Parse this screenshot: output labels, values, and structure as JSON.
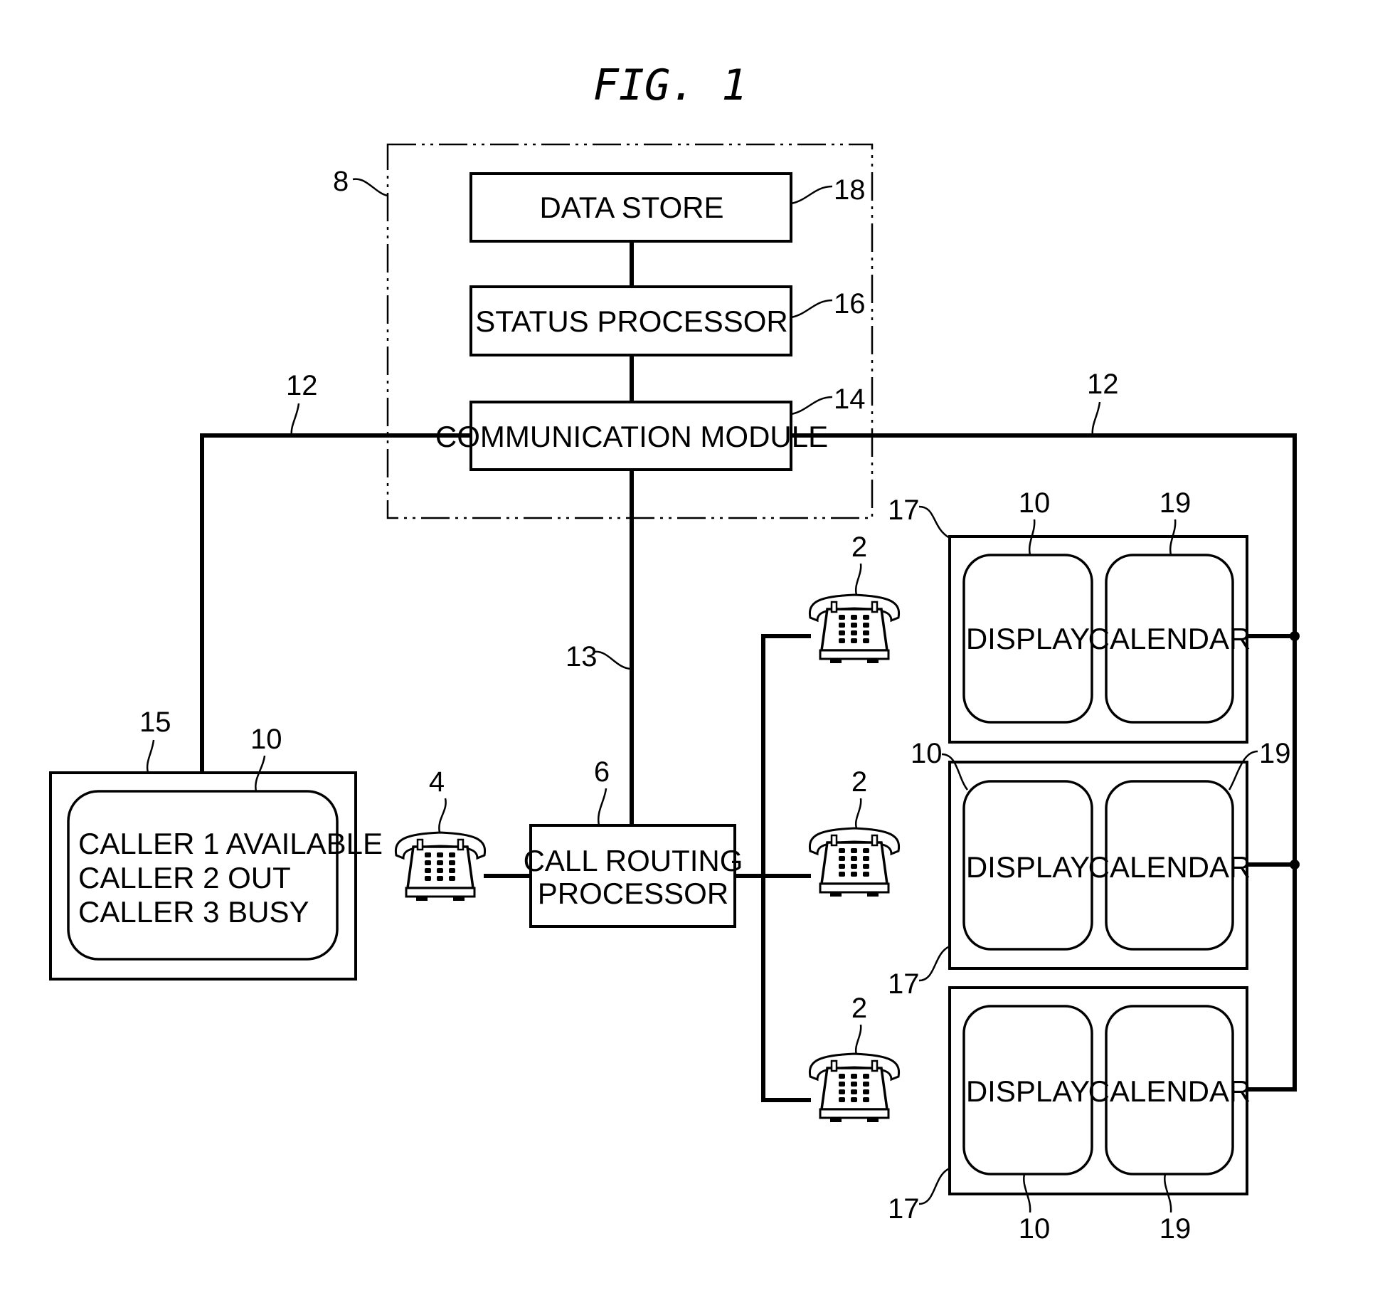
{
  "figure": {
    "title": "FIG. 1"
  },
  "system_boundary": {
    "ref": "8"
  },
  "blocks": {
    "data_store": {
      "label": "DATA STORE",
      "ref": "18"
    },
    "status_processor": {
      "label": "STATUS PROCESSOR",
      "ref": "16"
    },
    "communication_module": {
      "label": "COMMUNICATION MODULE",
      "ref": "14"
    },
    "call_routing_processor": {
      "label_line1": "CALL ROUTING",
      "label_line2": "PROCESSOR",
      "ref": "6"
    }
  },
  "links": {
    "network_left_ref": "12",
    "network_right_ref": "12",
    "routing_link_ref": "13"
  },
  "terminal": {
    "ref": "15",
    "display_ref": "10",
    "lines": [
      "CALLER 1 AVAILABLE",
      "CALLER 2 OUT",
      "CALLER 3 BUSY"
    ]
  },
  "caller_phone": {
    "ref": "4",
    "icon": "telephone-icon"
  },
  "user_phones": [
    {
      "ref": "2",
      "icon": "telephone-icon"
    },
    {
      "ref": "2",
      "icon": "telephone-icon"
    },
    {
      "ref": "2",
      "icon": "telephone-icon"
    }
  ],
  "panels": [
    {
      "ref": "17",
      "display_label": "DISPLAY",
      "display_ref": "10",
      "calendar_label": "CALENDAR",
      "calendar_ref": "19"
    },
    {
      "ref": "17",
      "display_label": "DISPLAY",
      "display_ref": "10",
      "calendar_label": "CALENDAR",
      "calendar_ref": "19"
    },
    {
      "ref": "17",
      "display_label": "DISPLAY",
      "display_ref": "10",
      "calendar_label": "CALENDAR",
      "calendar_ref": "19"
    }
  ]
}
